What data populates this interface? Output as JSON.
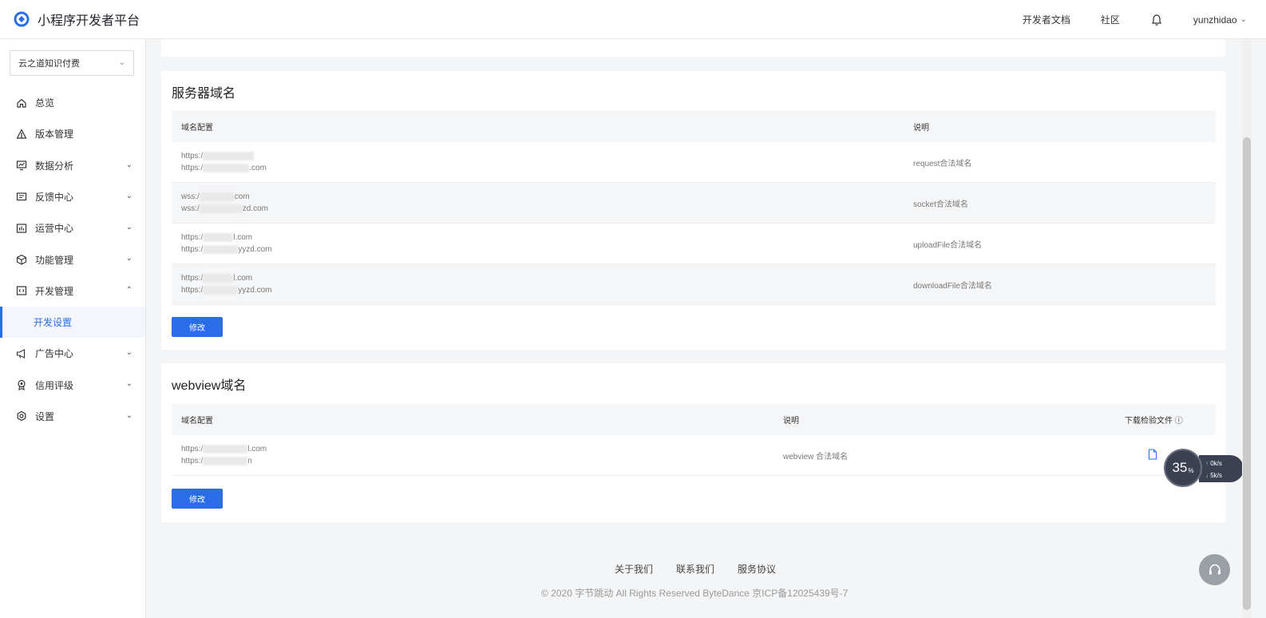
{
  "header": {
    "title": "小程序开发者平台",
    "nav": [
      "开发者文档",
      "社区"
    ],
    "user": "yunzhidao",
    "icons": {
      "logo": "brand-logo-icon",
      "bell": "bell-icon"
    }
  },
  "sidebar": {
    "app_select": "云之道知识付费",
    "items": [
      {
        "label": "总览",
        "icon": "home-icon"
      },
      {
        "label": "版本管理",
        "icon": "version-icon"
      },
      {
        "label": "数据分析",
        "icon": "chart-icon"
      },
      {
        "label": "反馈中心",
        "icon": "feedback-icon"
      },
      {
        "label": "运营中心",
        "icon": "operation-icon"
      },
      {
        "label": "功能管理",
        "icon": "cube-icon"
      },
      {
        "label": "开发管理",
        "icon": "code-icon"
      },
      {
        "label": "开发设置",
        "sub": true
      },
      {
        "label": "广告中心",
        "icon": "megaphone-icon"
      },
      {
        "label": "信用评级",
        "icon": "badge-icon"
      },
      {
        "label": "设置",
        "icon": "gear-icon"
      }
    ]
  },
  "server_domain": {
    "title": "服务器域名",
    "headers": [
      "域名配置",
      "说明"
    ],
    "rows": [
      {
        "urls": [
          "https:/",
          "https:/"
        ],
        "tail": [
          "",
          ".com"
        ],
        "desc": "request合法域名"
      },
      {
        "urls": [
          "wss:/",
          "wss:/"
        ],
        "tail": [
          "com",
          "zd.com"
        ],
        "desc": "socket合法域名"
      },
      {
        "urls": [
          "https:/",
          "https:/"
        ],
        "tail": [
          "l.com",
          "yyzd.com"
        ],
        "desc": "uploadFile合法域名"
      },
      {
        "urls": [
          "https:/",
          "https:/"
        ],
        "tail": [
          "l.com",
          "yyzd.com"
        ],
        "desc": "downloadFile合法域名"
      }
    ],
    "button": "修改"
  },
  "webview_domain": {
    "title": "webview域名",
    "headers": [
      "域名配置",
      "说明",
      "下载检验文件 ⓘ"
    ],
    "rows": [
      {
        "urls": [
          "https:/",
          "https:/"
        ],
        "tail": [
          "l.com",
          "n"
        ],
        "desc": "webview 合法域名"
      }
    ],
    "button": "修改"
  },
  "footer": {
    "links": [
      "关于我们",
      "联系我们",
      "服务协议"
    ],
    "copyright": "© 2020 字节跳动 All Rights Reserved ByteDance 京ICP备12025439号-7"
  },
  "speed_widget": {
    "percent": "35",
    "unit": "%",
    "up": "0k/s",
    "down": "5k/s"
  },
  "colors": {
    "accent": "#2b6de8"
  }
}
